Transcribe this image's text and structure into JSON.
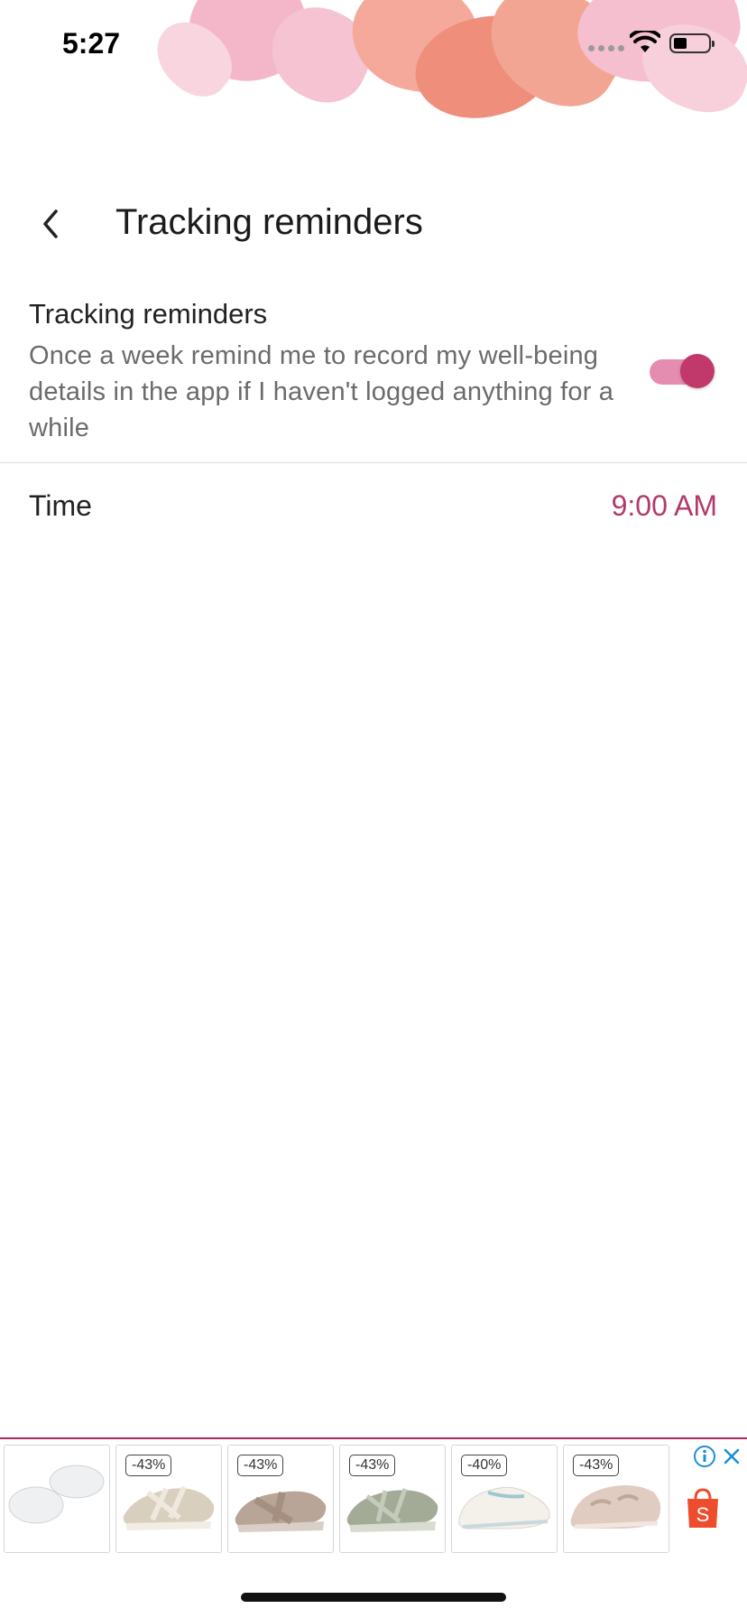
{
  "status_bar": {
    "time": "5:27"
  },
  "nav": {
    "title": "Tracking reminders"
  },
  "reminder": {
    "title": "Tracking reminders",
    "description": "Once a week remind me to record my well-being details in the app if I haven't logged anything for a while",
    "enabled": true
  },
  "time_row": {
    "label": "Time",
    "value": "9:00 AM"
  },
  "ad": {
    "products": [
      {
        "name": "gel-insoles",
        "discount": ""
      },
      {
        "name": "beige-sandal",
        "discount": "-43%"
      },
      {
        "name": "taupe-sandal",
        "discount": "-43%"
      },
      {
        "name": "green-sandal",
        "discount": "-43%"
      },
      {
        "name": "white-sneaker",
        "discount": "-40%"
      },
      {
        "name": "pink-sandal",
        "discount": "-43%"
      }
    ],
    "shop_icon_letter": "S"
  },
  "colors": {
    "accent": "#b23a6a",
    "toggle_knob": "#c1386a",
    "toggle_track": "#e58db0",
    "ad_border": "#a52a5e",
    "shop_orange": "#ee4d2d"
  }
}
